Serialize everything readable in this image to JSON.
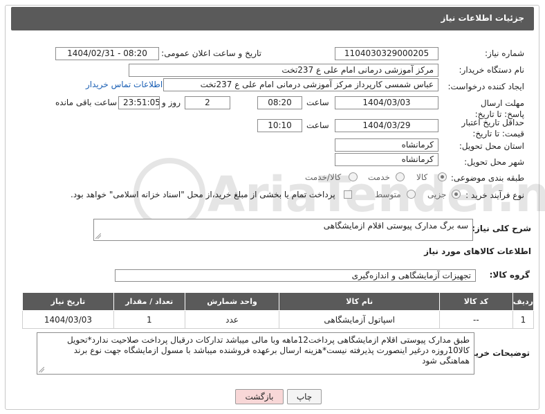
{
  "header": {
    "title": "جزئیات اطلاعات نیاز"
  },
  "labels": {
    "need_number": "شماره نیاز:",
    "announce_datetime": "تاریخ و ساعت اعلان عمومی:",
    "buyer_org": "نام دستگاه خریدار:",
    "requester": "ایجاد کننده درخواست:",
    "reply_deadline": "مهلت ارسال پاسخ: تا تاریخ:",
    "time_word": "ساعت",
    "day_and": "روز و",
    "remaining": "ساعت باقی مانده",
    "price_validity": "حداقل تاریخ اعتبار قیمت: تا تاریخ:",
    "delivery_province": "استان محل تحویل:",
    "delivery_city": "شهر محل تحویل:",
    "subject_class": "طبقه بندی موضوعی:",
    "process_type": "نوع فرآیند خرید :",
    "description": "شرح کلی نیاز:",
    "goods_info": "اطلاعات کالاهای مورد نیاز",
    "goods_group": "گروه کالا:",
    "buyer_notes": "توضیحات خریدار:"
  },
  "fields": {
    "need_number": "1104030329000205",
    "announce_datetime": "1404/02/31 - 08:20",
    "buyer_org": "مرکز آموزشی درمانی امام علی ع 237تخت",
    "requester": "عباس شمسی کارپرداز  مرکز آموزشی درمانی امام علی ع 237تخت",
    "contact_link": "اطلاعات تماس خریدار",
    "reply_date": "1404/03/03",
    "reply_time": "08:20",
    "reply_days": "2",
    "remaining_time": "23:51:05",
    "validity_date": "1404/03/29",
    "validity_time": "10:10",
    "province": "کرمانشاه",
    "city": "کرمانشاه",
    "description": "سه برگ مدارک پیوستی  اقلام ازمایشگاهی",
    "goods_group": "تجهیزات آزمایشگاهی و اندازه‌گیری",
    "buyer_notes": "طبق مدارک پیوستی اقلام ازمایشگاهی پرداخت12ماهه وبا مالی میباشد تدارکات درقبال پرداخت صلاحیت ندارد*تحویل کالا10روزه درغیر اینصورت پذیرفته نیست*هزینه ارسال برعهده فروشنده میباشد با مسول ازمایشگاه جهت نوع برند هماهنگی شود"
  },
  "subject_options": [
    {
      "label": "کالا",
      "selected": true
    },
    {
      "label": "خدمت",
      "selected": false
    },
    {
      "label": "کالا/خدمت",
      "selected": false
    }
  ],
  "process_options": [
    {
      "label": "جزیی",
      "selected": true
    },
    {
      "label": "متوسط",
      "selected": false
    }
  ],
  "treasury_note": "پرداخت تمام یا بخشی از مبلغ خرید،از محل \"اسناد خزانه اسلامی\" خواهد بود.",
  "table": {
    "headers": [
      "ردیف",
      "کد کالا",
      "نام کالا",
      "واحد شمارش",
      "تعداد / مقدار",
      "تاریخ نیاز"
    ],
    "rows": [
      [
        "1",
        "--",
        "اسپاتول آزمایشگاهی",
        "عدد",
        "1",
        "1404/03/03"
      ]
    ]
  },
  "buttons": {
    "print": "چاپ",
    "back": "بازگشت"
  },
  "watermark": "AriaTender.neT",
  "colors": {
    "header_bg": "#5a5a5a",
    "link": "#1a5fb4",
    "back_button_bg": "#f8d7d7"
  }
}
